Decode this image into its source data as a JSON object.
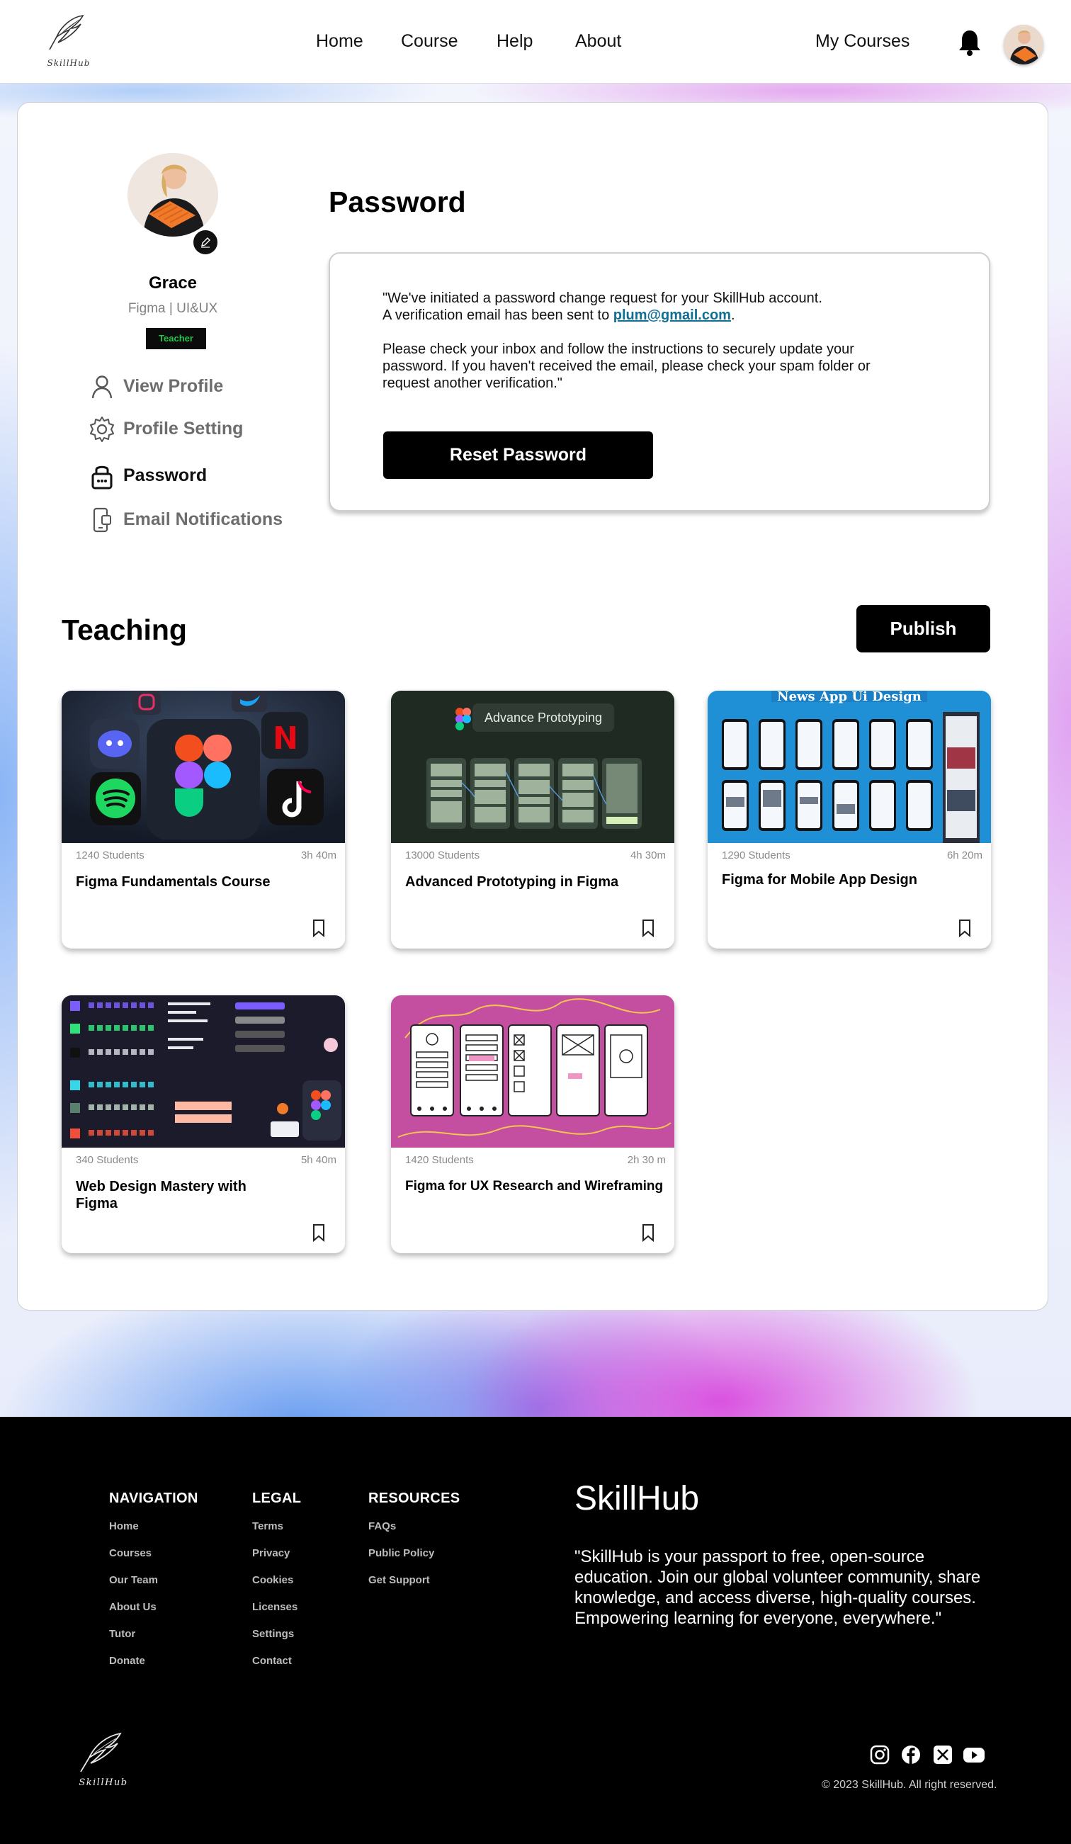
{
  "header": {
    "logo_text": "SkillHub",
    "nav": [
      "Home",
      "Course",
      "Help",
      "About"
    ],
    "my_courses": "My Courses"
  },
  "profile": {
    "name": "Grace",
    "role": "Figma | UI&UX",
    "badge": "Teacher"
  },
  "sidebar": {
    "items": [
      {
        "label": "View Profile",
        "icon": "user-icon"
      },
      {
        "label": "Profile Setting",
        "icon": "gear-icon"
      },
      {
        "label": "Password",
        "icon": "lock-icon"
      },
      {
        "label": "Email Notifications",
        "icon": "device-icon"
      }
    ],
    "active": "Password"
  },
  "password": {
    "title": "Password",
    "line1": "\"We've initiated a password change request for your SkillHub account.",
    "line2_prefix": "A verification email has been sent to ",
    "email": "plum@gmail.com",
    "line2_suffix": ".",
    "paragraph2": "Please check your inbox and follow the instructions to securely update your password. If you haven't received the email, please check your spam folder or request another verification.\"",
    "button": "Reset Password"
  },
  "teaching": {
    "title": "Teaching",
    "publish_button": "Publish",
    "courses": [
      {
        "students": "1240 Students",
        "duration": "3h 40m",
        "title": "Figma Fundamentals Course"
      },
      {
        "students": "13000 Students",
        "duration": "4h 30m",
        "title": "Advanced Prototyping in Figma",
        "thumb_text": "Advance Prototyping"
      },
      {
        "students": "1290 Students",
        "duration": "6h 20m",
        "title": "Figma for Mobile App Design",
        "thumb_text": "News App Ui Design"
      },
      {
        "students": "340 Students",
        "duration": "5h 40m",
        "title": "Web Design Mastery with Figma"
      },
      {
        "students": "1420 Students",
        "duration": "2h 30 m",
        "title": "Figma for UX Research and Wireframing"
      }
    ]
  },
  "footer": {
    "columns": [
      {
        "heading": "NAVIGATION",
        "links": [
          "Home",
          "Courses",
          "Our Team",
          "About Us",
          "Tutor",
          "Donate"
        ]
      },
      {
        "heading": "LEGAL",
        "links": [
          "Terms",
          "Privacy",
          "Cookies",
          "Licenses",
          "Settings",
          "Contact"
        ]
      },
      {
        "heading": "RESOURCES",
        "links": [
          "FAQs",
          "Public Policy",
          "Get Support"
        ]
      }
    ],
    "brand": "SkillHub",
    "description": "\"SkillHub is your passport to free, open-source education. Join our global volunteer community, share knowledge, and access diverse, high-quality courses. Empowering learning for everyone, everywhere.\"",
    "logo_text": "SkillHub",
    "social": [
      "instagram-icon",
      "facebook-icon",
      "x-icon",
      "youtube-icon"
    ],
    "copyright": "© 2023 SkillHub. All right reserved."
  },
  "colors": {
    "badge_green": "#22c443",
    "email_link": "#0f6f95",
    "mobile_thumb_bg": "#1f8fd6",
    "ux_thumb_bg": "#c44fa0",
    "proto_thumb_bg": "#1f2a22"
  }
}
